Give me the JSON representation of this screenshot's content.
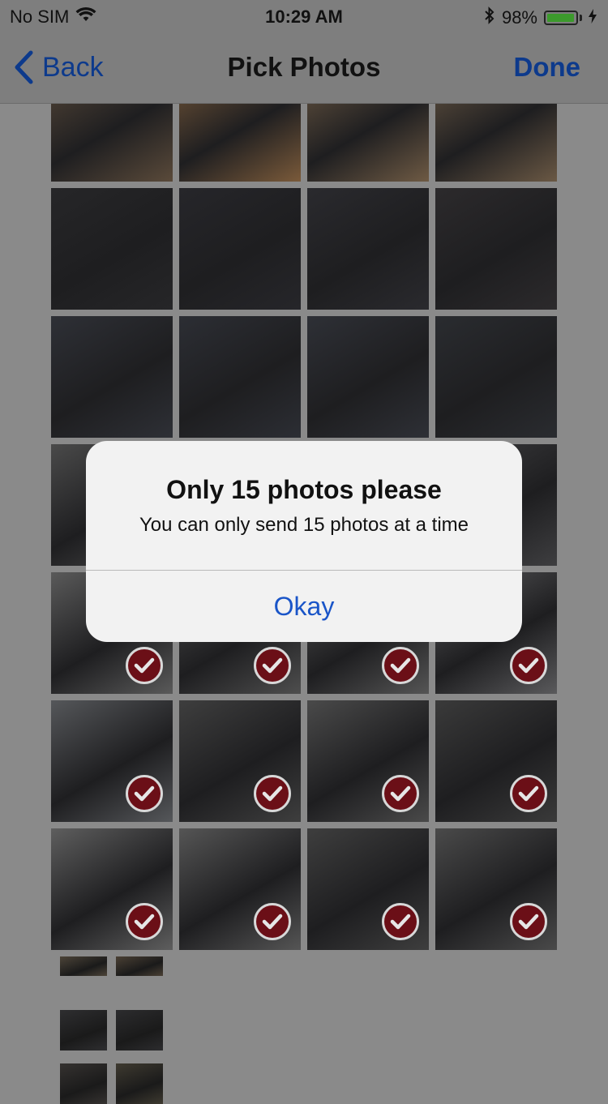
{
  "status": {
    "carrier": "No SIM",
    "time": "10:29 AM",
    "battery_text": "98%",
    "battery_level": 0.98,
    "icons": [
      "wifi-icon",
      "bluetooth-icon",
      "battery-icon",
      "charging-bolt-icon"
    ]
  },
  "nav": {
    "back_label": "Back",
    "title": "Pick Photos",
    "done_label": "Done"
  },
  "grid": {
    "columns": 4,
    "photos": [
      {
        "tone": "#5a4a3a",
        "selected": false
      },
      {
        "tone": "#7a5a3a",
        "selected": false
      },
      {
        "tone": "#6e5a44",
        "selected": false
      },
      {
        "tone": "#6a5844",
        "selected": false
      },
      {
        "tone": "#262628",
        "selected": false
      },
      {
        "tone": "#26262a",
        "selected": false
      },
      {
        "tone": "#2a2a2e",
        "selected": false
      },
      {
        "tone": "#2c2a2c",
        "selected": false
      },
      {
        "tone": "#2e3036",
        "selected": false
      },
      {
        "tone": "#2c2e34",
        "selected": false
      },
      {
        "tone": "#2e3036",
        "selected": false
      },
      {
        "tone": "#2a2c30",
        "selected": false
      },
      {
        "tone": "#4a4a4a",
        "selected": false
      },
      {
        "tone": "#505050",
        "selected": false
      },
      {
        "tone": "#4e4e4e",
        "selected": false
      },
      {
        "tone": "#3e3e40",
        "selected": false
      },
      {
        "tone": "#5a5a5a",
        "selected": true
      },
      {
        "tone": "#4e4e4e",
        "selected": true
      },
      {
        "tone": "#555555",
        "selected": true
      },
      {
        "tone": "#5a5a5c",
        "selected": true
      },
      {
        "tone": "#55575a",
        "selected": true
      },
      {
        "tone": "#3e3e3e",
        "selected": true
      },
      {
        "tone": "#4a4a4a",
        "selected": true
      },
      {
        "tone": "#3a3a3a",
        "selected": true
      },
      {
        "tone": "#5e5e5e",
        "selected": true
      },
      {
        "tone": "#555555",
        "selected": true
      },
      {
        "tone": "#3e3e3e",
        "selected": true
      },
      {
        "tone": "#4a4a4a",
        "selected": true
      }
    ],
    "small_thumbs": [
      "#4c4438",
      "#4a4034",
      "#2e2e30",
      "#2c2c2e",
      "#353230",
      "#3e3a30"
    ]
  },
  "alert": {
    "title": "Only 15 photos please",
    "message": "You can only send 15 photos at a time",
    "button_label": "Okay"
  }
}
